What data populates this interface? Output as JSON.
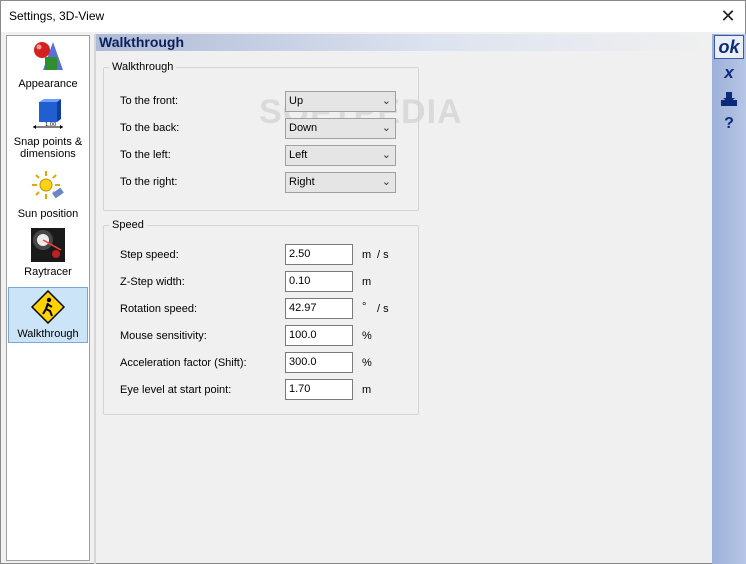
{
  "window": {
    "title": "Settings, 3D-View",
    "close_glyph": "✕"
  },
  "sidebar": {
    "items": [
      {
        "label": "Appearance",
        "icon": "appearance-shapes-icon",
        "selected": false
      },
      {
        "label": "Snap points & dimensions",
        "icon": "snap-dimensions-cube-icon",
        "selected": false
      },
      {
        "label": "Sun position",
        "icon": "sun-icon",
        "selected": false
      },
      {
        "label": "Raytracer",
        "icon": "raytracer-light-icon",
        "selected": false
      },
      {
        "label": "Walkthrough",
        "icon": "walkthrough-warning-sign-icon",
        "selected": true
      }
    ]
  },
  "header": {
    "title": "Walkthrough"
  },
  "rightbar": {
    "ok": "ok",
    "cancel": "x",
    "save_icon": "save-icon",
    "help": "?"
  },
  "walkthrough_group": {
    "title": "Walkthrough",
    "rows": [
      {
        "label": "To the front:",
        "value": "Up"
      },
      {
        "label": "To the back:",
        "value": "Down"
      },
      {
        "label": "To the left:",
        "value": "Left"
      },
      {
        "label": "To the right:",
        "value": "Right"
      }
    ]
  },
  "speed_group": {
    "title": "Speed",
    "rows": [
      {
        "label": "Step speed:",
        "value": "2.50",
        "unit": "m",
        "per": "/ s"
      },
      {
        "label": "Z-Step width:",
        "value": "0.10",
        "unit": "m",
        "per": ""
      },
      {
        "label": "Rotation speed:",
        "value": "42.97",
        "unit": "°",
        "per": "/ s"
      },
      {
        "label": "Mouse sensitivity:",
        "value": "100.0",
        "unit": "%",
        "per": ""
      },
      {
        "label": "Acceleration factor (Shift):",
        "value": "300.0",
        "unit": "%",
        "per": ""
      },
      {
        "label": "Eye level at start point:",
        "value": "1.70",
        "unit": "m",
        "per": ""
      }
    ]
  },
  "watermark": "SOFTPEDIA"
}
